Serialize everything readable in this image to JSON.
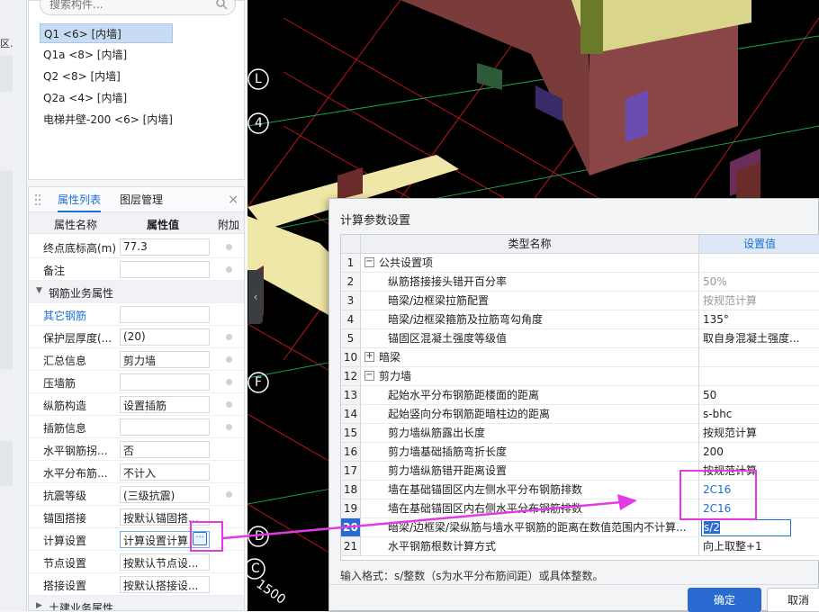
{
  "left_strip": {
    "fragment": "区."
  },
  "component_list": {
    "search_placeholder": "搜索构件...",
    "items": [
      {
        "label": "Q1 <6> [内墙]"
      },
      {
        "label": "Q1a <8> [内墙]"
      },
      {
        "label": "Q2 <8> [内墙]"
      },
      {
        "label": "Q2a <4> [内墙]"
      },
      {
        "label": "电梯井壁-200 <6> [内墙]"
      }
    ]
  },
  "property_panel": {
    "tabs": [
      {
        "label": "属性列表"
      },
      {
        "label": "图层管理"
      }
    ],
    "close_glyph": "×",
    "headers": {
      "name": "属性名称",
      "value": "属性值",
      "extra": "附加"
    },
    "rows": [
      {
        "name": "终点底标高(m)",
        "value": "77.3"
      },
      {
        "name": "备注",
        "value": ""
      },
      {
        "name": "钢筋业务属性",
        "value": ""
      },
      {
        "name": "其它钢筋",
        "value": ""
      },
      {
        "name": "保护层厚度(...",
        "value": "(20)"
      },
      {
        "name": "汇总信息",
        "value": "剪力墙"
      },
      {
        "name": "压墙筋",
        "value": ""
      },
      {
        "name": "纵筋构造",
        "value": "设置插筋"
      },
      {
        "name": "插筋信息",
        "value": ""
      },
      {
        "name": "水平钢筋拐...",
        "value": "否"
      },
      {
        "name": "水平分布筋...",
        "value": "不计入"
      },
      {
        "name": "抗震等级",
        "value": "(三级抗震)"
      },
      {
        "name": "锚固搭接",
        "value": "按默认锚固搭..."
      },
      {
        "name": "计算设置",
        "value": "计算设置计算"
      },
      {
        "name": "节点设置",
        "value": "按默认节点设..."
      },
      {
        "name": "搭接设置",
        "value": "按默认搭接设..."
      },
      {
        "name": "土建业务属性",
        "value": ""
      }
    ],
    "ellipsis_glyph": "···"
  },
  "viewport": {
    "axis_labels": [
      "L",
      "4",
      "F",
      "D",
      "C"
    ],
    "dimension_text": "1500",
    "collapse_glyph": "‹"
  },
  "dialog": {
    "title": "计算参数设置",
    "columns": {
      "name": "类型名称",
      "value": "设置值"
    },
    "rows": [
      {
        "num": "1",
        "name": "公共设置项",
        "value": "",
        "group": "minus"
      },
      {
        "num": "2",
        "name": "纵筋搭接接头错开百分率",
        "value": "50%",
        "style": "gray"
      },
      {
        "num": "3",
        "name": "暗梁/边框梁拉筋配置",
        "value": "按规范计算",
        "style": "gray"
      },
      {
        "num": "4",
        "name": "暗梁/边框梁箍筋及拉筋弯勾角度",
        "value": "135°"
      },
      {
        "num": "5",
        "name": "锚固区混凝土强度等级值",
        "value": "取自身混凝土强度..."
      },
      {
        "num": "10",
        "name": "暗梁",
        "value": "",
        "group": "plus"
      },
      {
        "num": "12",
        "name": "剪力墙",
        "value": "",
        "group": "minus"
      },
      {
        "num": "13",
        "name": "起始水平分布钢筋距楼面的距离",
        "value": "50"
      },
      {
        "num": "14",
        "name": "起始竖向分布钢筋距暗柱边的距离",
        "value": "s-bhc"
      },
      {
        "num": "15",
        "name": "剪力墙纵筋露出长度",
        "value": "按规范计算"
      },
      {
        "num": "16",
        "name": "剪力墙基础插筋弯折长度",
        "value": "200"
      },
      {
        "num": "17",
        "name": "剪力墙纵筋错开距离设置",
        "value": "按规范计算"
      },
      {
        "num": "18",
        "name": "墙在基础锚固区内左侧水平分布钢筋排数",
        "value": "2C16",
        "style": "blue"
      },
      {
        "num": "19",
        "name": "墙在基础锚固区内右侧水平分布钢筋排数",
        "value": "2C16",
        "style": "blue"
      },
      {
        "num": "20",
        "name": "暗梁/边框梁/梁纵筋与墙水平钢筋的距离在数值范围内不计算...",
        "value": "s/2",
        "current": true
      },
      {
        "num": "21",
        "name": "水平钢筋根数计算方式",
        "value": "向上取整+1"
      }
    ],
    "hint": "输入格式：s/整数（s为水平分布筋间距）或具体整数。",
    "ok_label": "确定",
    "cancel_label": "取消"
  },
  "colors": {
    "accent": "#2a6bd1",
    "annotation": "#e23be6"
  }
}
